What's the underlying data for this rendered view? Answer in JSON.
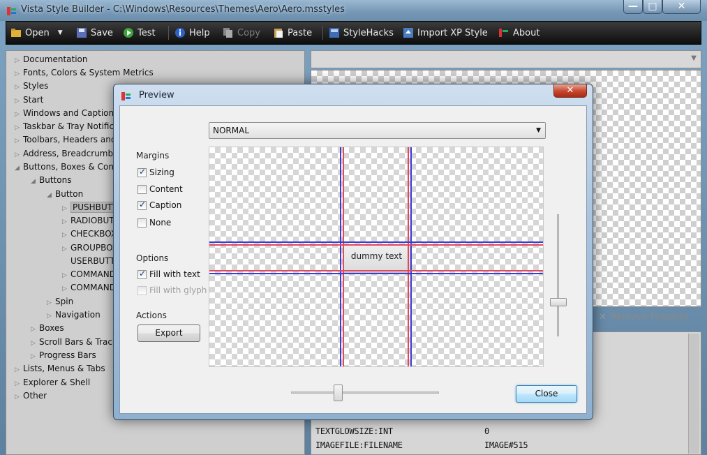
{
  "window": {
    "title": "Vista Style Builder - C:\\Windows\\Resources\\Themes\\Aero\\Aero.msstyles",
    "minimize": "—",
    "maximize": "□",
    "close": "✕"
  },
  "toolbar": {
    "open": "Open",
    "save": "Save",
    "test": "Test",
    "help": "Help",
    "copy": "Copy",
    "paste": "Paste",
    "stylehacks": "StyleHacks",
    "import_xp": "Import XP Style",
    "about": "About"
  },
  "tree": {
    "items": [
      {
        "label": "Documentation",
        "arrow": "▷"
      },
      {
        "label": "Fonts, Colors & System Metrics",
        "arrow": "▷"
      },
      {
        "label": "Styles",
        "arrow": "▷"
      },
      {
        "label": "Start",
        "arrow": "▷"
      },
      {
        "label": "Windows and Captions",
        "arrow": "▷"
      },
      {
        "label": "Taskbar & Tray Notification",
        "arrow": "▷"
      },
      {
        "label": "Toolbars, Headers and Rebar",
        "arrow": "▷"
      },
      {
        "label": "Address, Breadcrumbs & Search",
        "arrow": "▷"
      },
      {
        "label": "Buttons, Boxes & Controls",
        "arrow": "◢"
      },
      {
        "label": "Buttons",
        "arrow": "◢"
      },
      {
        "label": "Button",
        "arrow": "◢"
      },
      {
        "label": "PUSHBUTTON",
        "arrow": "▷"
      },
      {
        "label": "RADIOBUTTON",
        "arrow": "▷"
      },
      {
        "label": "CHECKBOX",
        "arrow": "▷"
      },
      {
        "label": "GROUPBOX",
        "arrow": "▷"
      },
      {
        "label": "USERBUTTON",
        "arrow": ""
      },
      {
        "label": "COMMANDLINK",
        "arrow": "▷"
      },
      {
        "label": "COMMANDLINKGLYPH",
        "arrow": "▷"
      },
      {
        "label": "Spin",
        "arrow": "▷"
      },
      {
        "label": "Navigation",
        "arrow": "▷"
      },
      {
        "label": "Boxes",
        "arrow": "▷"
      },
      {
        "label": "Scroll Bars & Trackbars",
        "arrow": "▷"
      },
      {
        "label": "Progress Bars",
        "arrow": "▷"
      },
      {
        "label": "Lists, Menus & Tabs",
        "arrow": "▷"
      },
      {
        "label": "Explorer & Shell",
        "arrow": "▷"
      },
      {
        "label": "Other",
        "arrow": "▷"
      }
    ]
  },
  "right": {
    "remove_property": "Remove Property",
    "props": [
      {
        "name": "TEXTGLOWSIZE:INT",
        "value": "0"
      },
      {
        "name": "IMAGEFILE:FILENAME",
        "value": "IMAGE#515"
      }
    ]
  },
  "dialog": {
    "title": "Preview",
    "close_glyph": "✕",
    "state_select": "NORMAL",
    "dropdown_glyph": "▼",
    "margins_label": "Margins",
    "margins": [
      {
        "label": "Sizing",
        "checked": true
      },
      {
        "label": "Content",
        "checked": false
      },
      {
        "label": "Caption",
        "checked": true
      },
      {
        "label": "None",
        "checked": false
      }
    ],
    "options_label": "Options",
    "options": [
      {
        "label": "Fill with text",
        "checked": true
      },
      {
        "label": "Fill with glyph",
        "checked": false,
        "disabled": true
      }
    ],
    "actions_label": "Actions",
    "export_button": "Export",
    "close_button": "Close",
    "dummy_text": "dummy text"
  },
  "colors": {
    "sizing_margin": "#3b3bd8",
    "caption_margin": "#e04a5a",
    "close_red": "#c6452d",
    "toolbar_bg": "#1e1e1e"
  }
}
